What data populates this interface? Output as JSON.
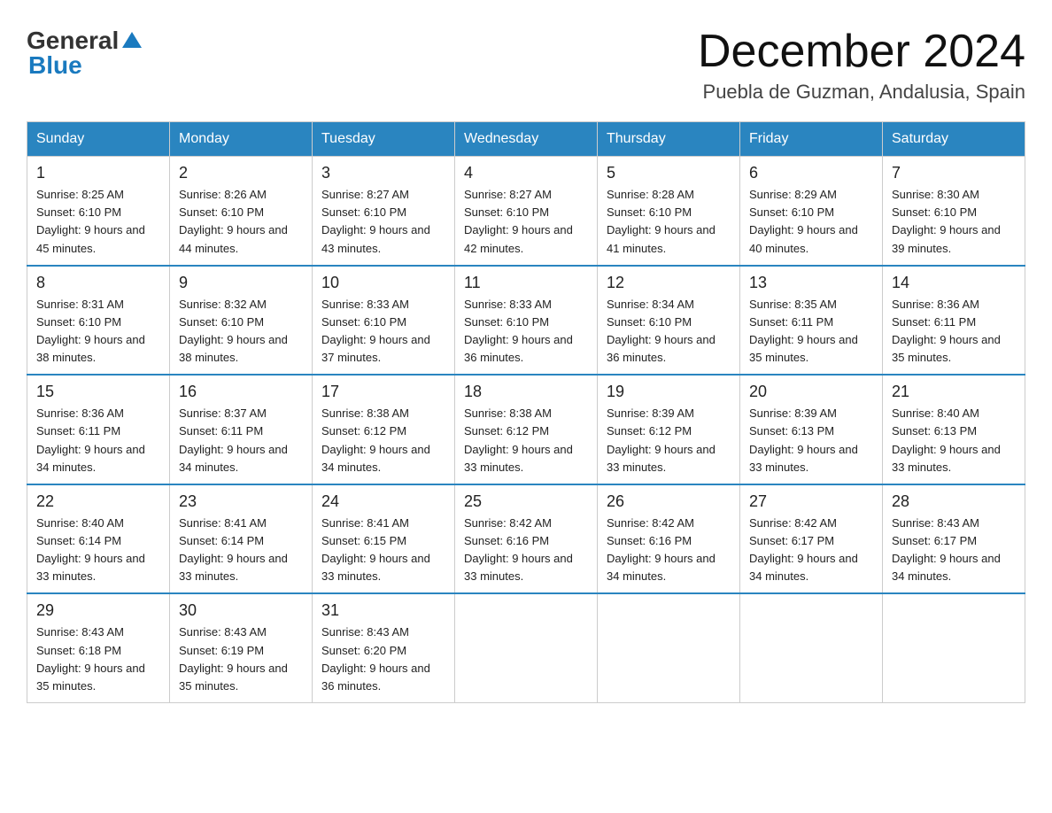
{
  "header": {
    "title": "December 2024",
    "subtitle": "Puebla de Guzman, Andalusia, Spain",
    "logo_general": "General",
    "logo_blue": "Blue"
  },
  "days_of_week": [
    "Sunday",
    "Monday",
    "Tuesday",
    "Wednesday",
    "Thursday",
    "Friday",
    "Saturday"
  ],
  "weeks": [
    [
      {
        "date": "1",
        "sunrise": "8:25 AM",
        "sunset": "6:10 PM",
        "daylight": "9 hours and 45 minutes."
      },
      {
        "date": "2",
        "sunrise": "8:26 AM",
        "sunset": "6:10 PM",
        "daylight": "9 hours and 44 minutes."
      },
      {
        "date": "3",
        "sunrise": "8:27 AM",
        "sunset": "6:10 PM",
        "daylight": "9 hours and 43 minutes."
      },
      {
        "date": "4",
        "sunrise": "8:27 AM",
        "sunset": "6:10 PM",
        "daylight": "9 hours and 42 minutes."
      },
      {
        "date": "5",
        "sunrise": "8:28 AM",
        "sunset": "6:10 PM",
        "daylight": "9 hours and 41 minutes."
      },
      {
        "date": "6",
        "sunrise": "8:29 AM",
        "sunset": "6:10 PM",
        "daylight": "9 hours and 40 minutes."
      },
      {
        "date": "7",
        "sunrise": "8:30 AM",
        "sunset": "6:10 PM",
        "daylight": "9 hours and 39 minutes."
      }
    ],
    [
      {
        "date": "8",
        "sunrise": "8:31 AM",
        "sunset": "6:10 PM",
        "daylight": "9 hours and 38 minutes."
      },
      {
        "date": "9",
        "sunrise": "8:32 AM",
        "sunset": "6:10 PM",
        "daylight": "9 hours and 38 minutes."
      },
      {
        "date": "10",
        "sunrise": "8:33 AM",
        "sunset": "6:10 PM",
        "daylight": "9 hours and 37 minutes."
      },
      {
        "date": "11",
        "sunrise": "8:33 AM",
        "sunset": "6:10 PM",
        "daylight": "9 hours and 36 minutes."
      },
      {
        "date": "12",
        "sunrise": "8:34 AM",
        "sunset": "6:10 PM",
        "daylight": "9 hours and 36 minutes."
      },
      {
        "date": "13",
        "sunrise": "8:35 AM",
        "sunset": "6:11 PM",
        "daylight": "9 hours and 35 minutes."
      },
      {
        "date": "14",
        "sunrise": "8:36 AM",
        "sunset": "6:11 PM",
        "daylight": "9 hours and 35 minutes."
      }
    ],
    [
      {
        "date": "15",
        "sunrise": "8:36 AM",
        "sunset": "6:11 PM",
        "daylight": "9 hours and 34 minutes."
      },
      {
        "date": "16",
        "sunrise": "8:37 AM",
        "sunset": "6:11 PM",
        "daylight": "9 hours and 34 minutes."
      },
      {
        "date": "17",
        "sunrise": "8:38 AM",
        "sunset": "6:12 PM",
        "daylight": "9 hours and 34 minutes."
      },
      {
        "date": "18",
        "sunrise": "8:38 AM",
        "sunset": "6:12 PM",
        "daylight": "9 hours and 33 minutes."
      },
      {
        "date": "19",
        "sunrise": "8:39 AM",
        "sunset": "6:12 PM",
        "daylight": "9 hours and 33 minutes."
      },
      {
        "date": "20",
        "sunrise": "8:39 AM",
        "sunset": "6:13 PM",
        "daylight": "9 hours and 33 minutes."
      },
      {
        "date": "21",
        "sunrise": "8:40 AM",
        "sunset": "6:13 PM",
        "daylight": "9 hours and 33 minutes."
      }
    ],
    [
      {
        "date": "22",
        "sunrise": "8:40 AM",
        "sunset": "6:14 PM",
        "daylight": "9 hours and 33 minutes."
      },
      {
        "date": "23",
        "sunrise": "8:41 AM",
        "sunset": "6:14 PM",
        "daylight": "9 hours and 33 minutes."
      },
      {
        "date": "24",
        "sunrise": "8:41 AM",
        "sunset": "6:15 PM",
        "daylight": "9 hours and 33 minutes."
      },
      {
        "date": "25",
        "sunrise": "8:42 AM",
        "sunset": "6:16 PM",
        "daylight": "9 hours and 33 minutes."
      },
      {
        "date": "26",
        "sunrise": "8:42 AM",
        "sunset": "6:16 PM",
        "daylight": "9 hours and 34 minutes."
      },
      {
        "date": "27",
        "sunrise": "8:42 AM",
        "sunset": "6:17 PM",
        "daylight": "9 hours and 34 minutes."
      },
      {
        "date": "28",
        "sunrise": "8:43 AM",
        "sunset": "6:17 PM",
        "daylight": "9 hours and 34 minutes."
      }
    ],
    [
      {
        "date": "29",
        "sunrise": "8:43 AM",
        "sunset": "6:18 PM",
        "daylight": "9 hours and 35 minutes."
      },
      {
        "date": "30",
        "sunrise": "8:43 AM",
        "sunset": "6:19 PM",
        "daylight": "9 hours and 35 minutes."
      },
      {
        "date": "31",
        "sunrise": "8:43 AM",
        "sunset": "6:20 PM",
        "daylight": "9 hours and 36 minutes."
      },
      null,
      null,
      null,
      null
    ]
  ]
}
